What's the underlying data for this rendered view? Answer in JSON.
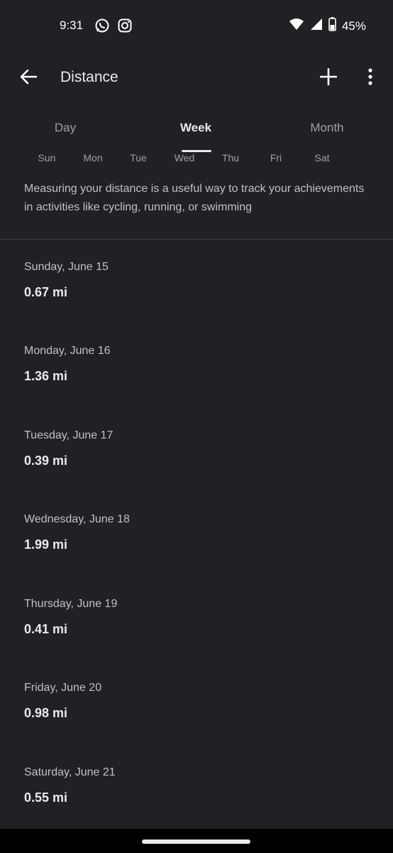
{
  "status_bar": {
    "time": "9:31",
    "battery": "45%",
    "icons": [
      "whatsapp-icon",
      "instagram-icon",
      "wifi-icon",
      "signal-icon",
      "battery-icon"
    ]
  },
  "app_bar": {
    "title": "Distance",
    "icons": [
      "back-arrow-icon",
      "add-icon",
      "more-vert-icon"
    ]
  },
  "period_tabs": [
    {
      "label": "Day",
      "active": false
    },
    {
      "label": "Week",
      "active": true
    },
    {
      "label": "Month",
      "active": false
    }
  ],
  "day_tabs": [
    {
      "label": "Sun"
    },
    {
      "label": "Mon"
    },
    {
      "label": "Tue"
    },
    {
      "label": "Wed",
      "selected": true
    },
    {
      "label": "Thu"
    },
    {
      "label": "Fri"
    },
    {
      "label": "Sat"
    }
  ],
  "description": "Measuring your distance is a useful way to track your achievements in activities like cycling, running, or swimming",
  "entries": [
    {
      "date": "Sunday, June 15",
      "value": "0.67 mi"
    },
    {
      "date": "Monday, June 16",
      "value": "1.36 mi"
    },
    {
      "date": "Tuesday, June 17",
      "value": "0.39 mi"
    },
    {
      "date": "Wednesday, June 18",
      "value": "1.99 mi"
    },
    {
      "date": "Thursday, June 19",
      "value": "0.41 mi"
    },
    {
      "date": "Friday, June 20",
      "value": "0.98 mi"
    },
    {
      "date": "Saturday, June 21",
      "value": "0.55 mi"
    }
  ],
  "colors": {
    "background": "#202124",
    "text_primary": "#e8eaed",
    "text_secondary": "#9aa0a6"
  }
}
